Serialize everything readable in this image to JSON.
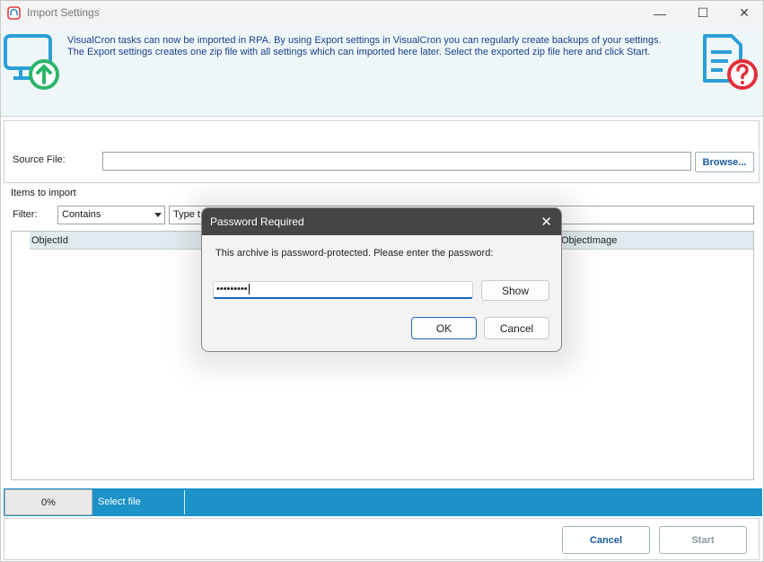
{
  "window": {
    "title": "Import Settings",
    "minimize_glyph": "—",
    "maximize_glyph": "☐",
    "close_glyph": "✕"
  },
  "header": {
    "line1": "VisualCron tasks can now be imported in RPA. By using Export settings in VisualCron you can regularly create backups of your settings.",
    "line2": "The Export settings creates one zip file with all settings which can imported here later. Select the exported zip file here and click Start.",
    "left_icon": "monitor-upload-icon",
    "right_icon": "document-help-icon"
  },
  "source": {
    "label": "Source File:",
    "value": "",
    "browse_label": "Browse..."
  },
  "items": {
    "label": "Items to import",
    "filter_label": "Filter:",
    "filter_mode": "Contains",
    "filter_placeholder": "Type t",
    "columns": [
      "ObjectId",
      "ObjectImage"
    ]
  },
  "status": {
    "progress_text": "0%",
    "progress": 0,
    "message": "Select file"
  },
  "footer": {
    "cancel_label": "Cancel",
    "start_label": "Start"
  },
  "dialog": {
    "title": "Password Required",
    "close_glyph": "✕",
    "message": "This archive is password-protected. Please enter the password:",
    "password_mask": "•••••••••",
    "show_label": "Show",
    "ok_label": "OK",
    "cancel_label": "Cancel"
  },
  "colors": {
    "accent": "#1c92c9",
    "header_text": "#1b3f8a",
    "button_text": "#1b5aa0",
    "dialog_title_bg": "#454545"
  }
}
